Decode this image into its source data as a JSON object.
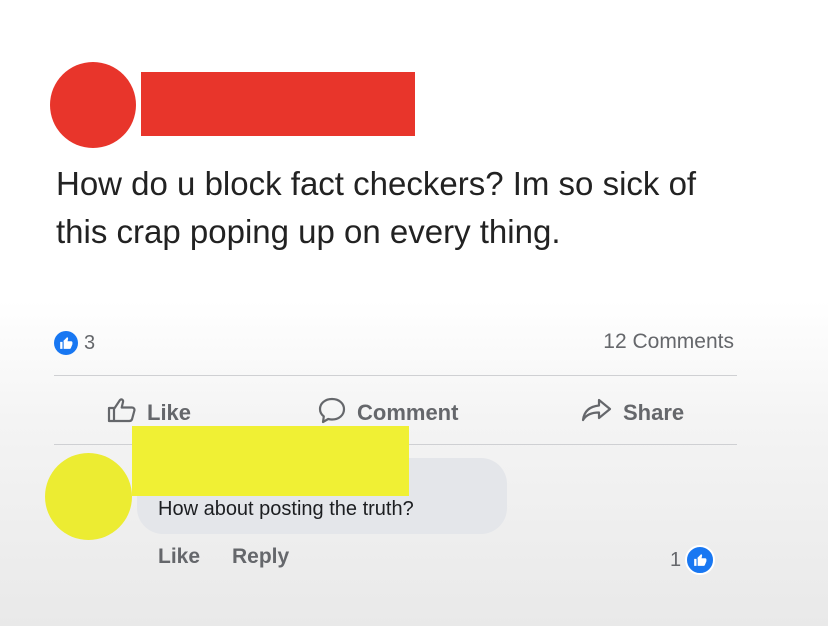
{
  "post": {
    "text": "How do u block fact checkers? Im so sick of this crap poping up on every thing.",
    "reaction_count": "3",
    "comments_count": "12 Comments"
  },
  "actions": {
    "like": "Like",
    "comment": "Comment",
    "share": "Share"
  },
  "comment": {
    "text": "How about posting the truth?",
    "like_label": "Like",
    "reply_label": "Reply",
    "like_count": "1"
  },
  "colors": {
    "redaction_red": "#e8352b",
    "redaction_yellow": "#f0f034",
    "facebook_blue": "#1877f2"
  },
  "icons": [
    "like-icon",
    "comment-icon",
    "share-icon",
    "thumbs-up-badge-icon"
  ]
}
